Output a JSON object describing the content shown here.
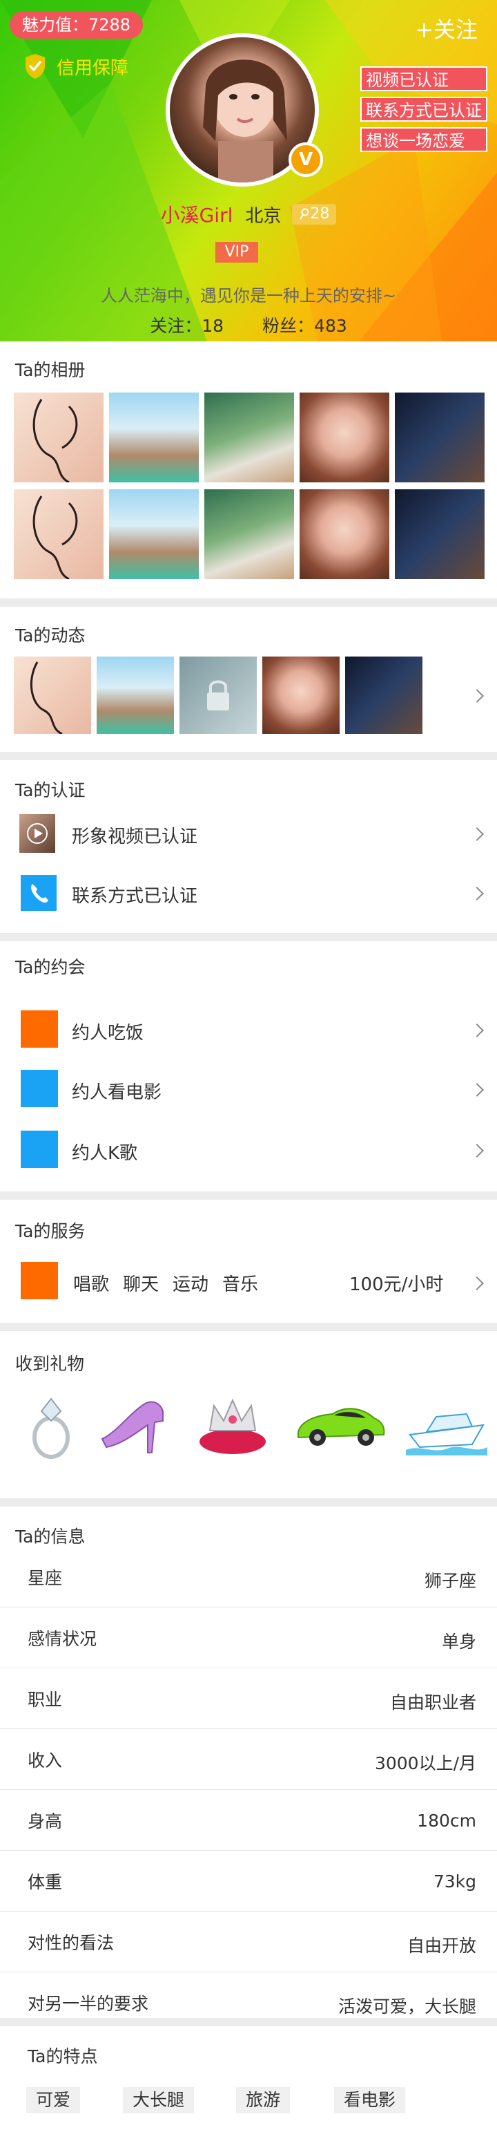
{
  "profile": {
    "charm": "魅力值：7288",
    "guarantee": "信用保障",
    "follow": "+关注",
    "name": "小溪Girl",
    "city": "北京",
    "age": "28",
    "vip": "VIP",
    "badge": "V",
    "motto": "人人茫海中，遇见你是一种上天的安排~",
    "follows": "关注：18",
    "fans": "粉丝：483",
    "certs": [
      "视频已认证",
      "联系方式已认证",
      "想谈一场恋爱"
    ]
  },
  "album": {
    "title": "Ta的相册"
  },
  "feed": {
    "title": "Ta的动态"
  },
  "verify": {
    "title": "Ta的认证",
    "items": [
      "形象视频已认证",
      "联系方式已认证"
    ]
  },
  "dates": {
    "title": "Ta的约会",
    "items": [
      "约人吃饭",
      "约人看电影",
      "约人K歌"
    ]
  },
  "service": {
    "title": "Ta的服务",
    "tags": [
      "唱歌",
      "聊天",
      "运动",
      "音乐"
    ],
    "price": "100元/小时"
  },
  "gifts": {
    "title": "收到礼物",
    "icons": [
      "ring-icon",
      "high-heel-icon",
      "crown-icon",
      "sports-car-icon",
      "yacht-icon"
    ]
  },
  "info": {
    "title": "Ta的信息",
    "rows": [
      {
        "k": "星座",
        "v": "狮子座"
      },
      {
        "k": "感情状况",
        "v": "单身"
      },
      {
        "k": "职业",
        "v": "自由职业者"
      },
      {
        "k": "收入",
        "v": "3000以上/月"
      },
      {
        "k": "身高",
        "v": "180cm"
      },
      {
        "k": "体重",
        "v": "73kg"
      },
      {
        "k": "对性的看法",
        "v": "自由开放"
      },
      {
        "k": "对另一半的要求",
        "v": "活泼可爱，大长腿"
      }
    ]
  },
  "traits": {
    "title": "Ta的特点",
    "items": [
      "可爱",
      "大长腿",
      "旅游",
      "看电影"
    ]
  },
  "colors": {
    "accent_red": "#f2545b",
    "orange_square": "#ff6a00",
    "blue_square": "#1aa3f5",
    "name_pink": "#e8204e"
  }
}
